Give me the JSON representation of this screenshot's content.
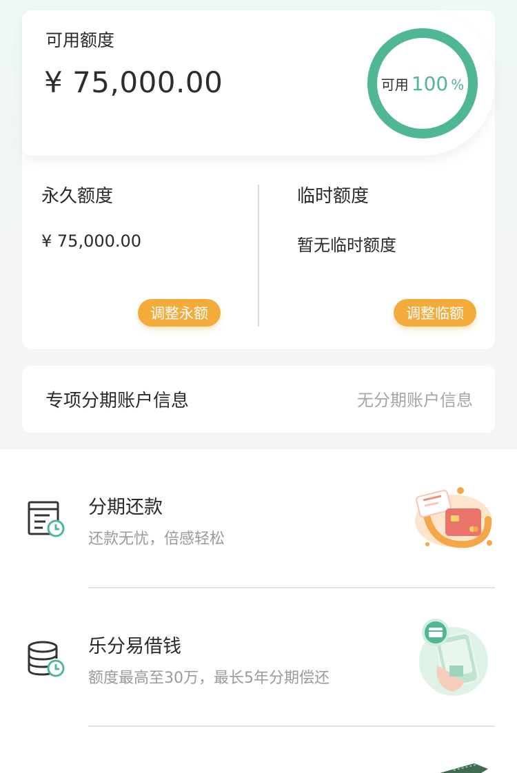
{
  "available": {
    "label": "可用额度",
    "amount": "¥ 75,000.00",
    "ring_label": "可用",
    "ring_percent": "100",
    "ring_percent_sign": "%",
    "ring_fill_fraction": 1.0
  },
  "colors": {
    "accent_green": "#4fb794",
    "button_orange": "#f3ac3c",
    "muted_text": "#9a9a9a"
  },
  "permanent": {
    "title": "永久额度",
    "value": "¥ 75,000.00",
    "button": "调整永额"
  },
  "temporary": {
    "title": "临时额度",
    "value": "暂无临时额度",
    "button": "调整临额"
  },
  "installment_account": {
    "title": "专项分期账户信息",
    "value": "无分期账户信息"
  },
  "services": [
    {
      "title": "分期还款",
      "desc": "还款无忧，倍感轻松",
      "icon": "bill-clock-icon"
    },
    {
      "title": "乐分易借钱",
      "desc": "额度最高至30万，最长5年分期偿还",
      "icon": "coins-clock-icon"
    }
  ]
}
